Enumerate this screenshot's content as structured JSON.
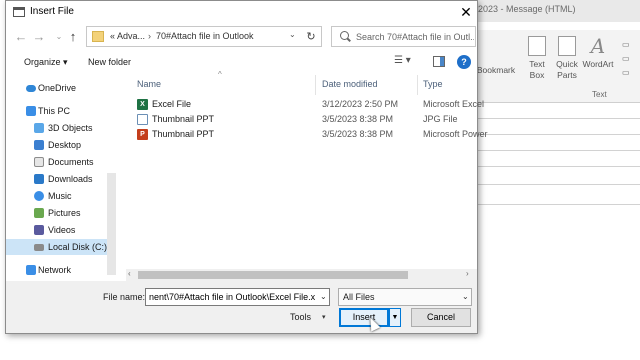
{
  "background_app": {
    "title": "2023 - Message (HTML)",
    "ribbon": {
      "bookmark": "Bookmark",
      "text_box": "Text Box",
      "quick_parts": "Quick Parts",
      "wordart": "WordArt",
      "group_text": "Text"
    }
  },
  "dialog": {
    "title": "Insert File",
    "address": {
      "part1": "« Adva...",
      "part2": "70#Attach file in Outlook"
    },
    "search": {
      "placeholder": "Search 70#Attach file in Outl..."
    },
    "toolbar": {
      "organize": "Organize ▾",
      "new_folder": "New folder"
    },
    "nav": [
      {
        "label": "OneDrive",
        "icon": "cloud-icon"
      },
      {
        "label": "This PC",
        "icon": "computer-icon"
      },
      {
        "label": "3D Objects",
        "icon": "cube-icon"
      },
      {
        "label": "Desktop",
        "icon": "desktop-icon"
      },
      {
        "label": "Documents",
        "icon": "document-icon"
      },
      {
        "label": "Downloads",
        "icon": "download-icon"
      },
      {
        "label": "Music",
        "icon": "music-icon"
      },
      {
        "label": "Pictures",
        "icon": "picture-icon"
      },
      {
        "label": "Videos",
        "icon": "video-icon"
      },
      {
        "label": "Local Disk (C:)",
        "icon": "disk-icon"
      },
      {
        "label": "Network",
        "icon": "network-icon"
      }
    ],
    "columns": {
      "name": "Name",
      "date": "Date modified",
      "type": "Type"
    },
    "files": [
      {
        "name": "Excel File",
        "date": "3/12/2023 2:50 PM",
        "type": "Microsoft Excel",
        "icon": "excel-icon"
      },
      {
        "name": "Thumbnail PPT",
        "date": "3/5/2023 8:38 PM",
        "type": "JPG File",
        "icon": "image-icon"
      },
      {
        "name": "Thumbnail PPT",
        "date": "3/5/2023 8:38 PM",
        "type": "Microsoft Power",
        "icon": "powerpoint-icon"
      }
    ],
    "bottom": {
      "file_name_label": "File name:",
      "file_name_value": "nent\\70#Attach file in Outlook\\Excel File.xlsx",
      "file_type": "All Files",
      "tools": "Tools",
      "insert": "Insert",
      "cancel": "Cancel"
    }
  },
  "colors": {
    "accent": "#0078d7",
    "selection": "#cce4f7",
    "help": "#1e6fc9"
  }
}
